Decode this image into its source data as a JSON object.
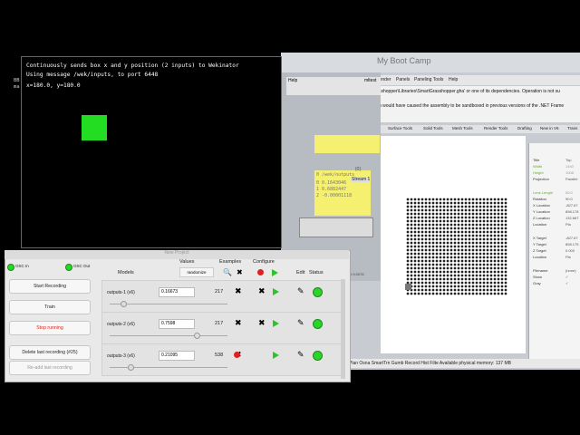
{
  "terminal": {
    "line1": "Continuously sends box x and y position (2 inputs) to Wekinator",
    "line2": "Using message /wek/inputs, to port 6448",
    "line3": "x=180.0, y=180.0"
  },
  "left_strip": {
    "a": "BB",
    "b": "ma"
  },
  "rhino": {
    "window_title": "My Boot Camp",
    "menu": [
      "Render",
      "Panels",
      "Paneling Tools",
      "Help"
    ],
    "cmd_line1": "sshopper\\Libraries\\SmartGrasshopper.gha' or one of its dependencies. Operation is not su",
    "cmd_line2": "h would have caused the assembly to be sandboxed in previous versions of the .NET Frame",
    "tabs": [
      "Surface Tools",
      "Solid Tools",
      "Mesh Tools",
      "Render Tools",
      "Drafting",
      "New in V6",
      "Trans"
    ],
    "props_labels": [
      "Title",
      "Width",
      "Height",
      "Projection",
      "Lens Length",
      "Rotation",
      "X Location",
      "Y Location",
      "Z Location",
      "Location",
      "X Target",
      "Y Target",
      "Z Target",
      "Location",
      "Filename",
      "Show",
      "Gray"
    ],
    "props_values": [
      "Top",
      "1440",
      "1008",
      "Parallel",
      "50.0",
      "90.0",
      "-827.67",
      "898.178",
      "132.667",
      "Pla",
      "-827.67",
      "898.175",
      "0.000",
      "Pla",
      "(none)",
      "✓",
      "✓"
    ],
    "status_text": "Plan  Osna  SmartTrn  Gumb  Record Hist  Filte  Available physical memory: 137 MB"
  },
  "grasshopper": {
    "menu_help": "Help",
    "file_label": "mltest",
    "panel_header": "0 /wek/outputs",
    "panel_lines": [
      "0 0.1643046",
      "1 0.6882447",
      "2 -0.00001118"
    ],
    "panel_tag": "{0}",
    "stream_label": "Stream 1",
    "zoom": "0.9.0076"
  },
  "wekinator": {
    "title": "New Project",
    "osc_in": "OSC In",
    "osc_out": "OSC Out",
    "buttons": {
      "start": "Start Recording",
      "train": "Train",
      "stop": "Stop running",
      "delete": "Delete last recording (#25)",
      "readd": "Re-add last recording"
    },
    "headers": {
      "models": "Models",
      "values": "Values",
      "randomize": "randomize",
      "examples": "Examples",
      "configure": "Configure",
      "edit": "Edit",
      "status": "Status"
    },
    "rows": [
      {
        "name": "outputs-1 (v6)",
        "value": "0.16673",
        "examples": "217",
        "slider": 0.17
      },
      {
        "name": "outputs-2 (v6)",
        "value": "0.7598",
        "examples": "217",
        "slider": 0.76
      },
      {
        "name": "outputs-3 (v6)",
        "value": "0.21095",
        "examples": "538",
        "slider": 0.21
      }
    ],
    "colors": {
      "led": "#2bd42b",
      "record": "#e02020",
      "play": "#2bc42b",
      "stop_text": "#e02020"
    }
  }
}
